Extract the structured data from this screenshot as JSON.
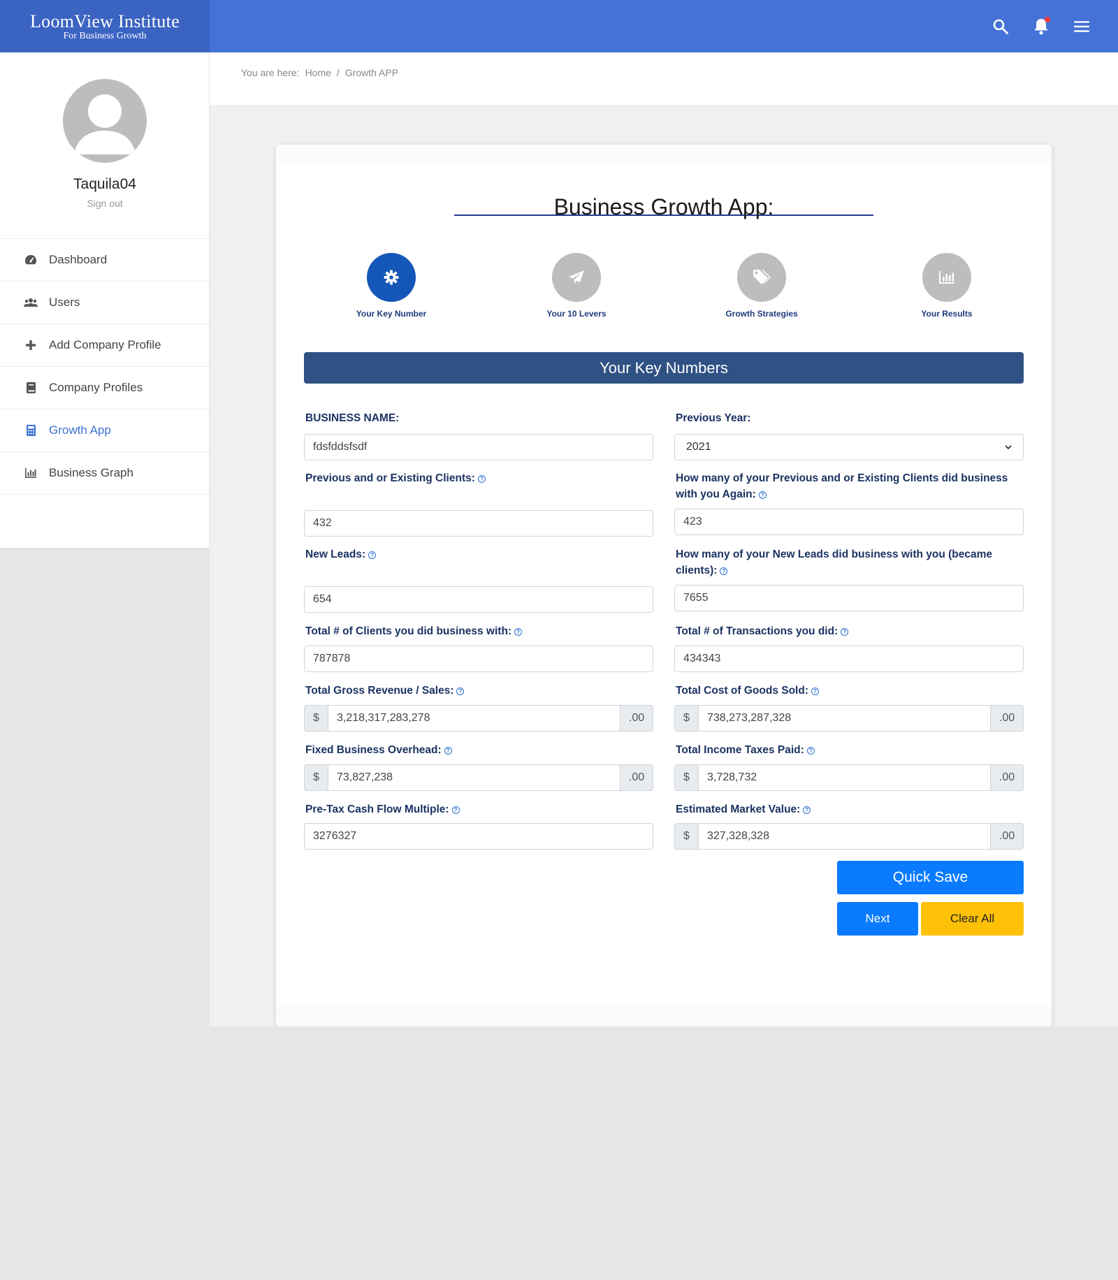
{
  "header": {
    "logo_line1": "LoomView Institute",
    "logo_line2": "For Business Growth",
    "icons": [
      "search-icon",
      "bell-icon",
      "menu-icon"
    ],
    "brand_color": "#4472d6"
  },
  "sidebar": {
    "username": "Taquila04",
    "signout": "Sign out",
    "items": [
      {
        "label": "Dashboard",
        "icon": "dashboard-icon"
      },
      {
        "label": "Users",
        "icon": "users-icon"
      },
      {
        "label": "Add Company Profile",
        "icon": "plus-icon"
      },
      {
        "label": "Company Profiles",
        "icon": "book-icon"
      },
      {
        "label": "Growth App",
        "icon": "calculator-icon",
        "active": true
      },
      {
        "label": "Business Graph",
        "icon": "bar-chart-icon"
      }
    ]
  },
  "breadcrumb": {
    "prefix": "You are here:",
    "home": "Home",
    "separator": "/",
    "current": "Growth APP"
  },
  "app": {
    "title": "Business Growth App:",
    "steps": [
      {
        "label": "Your Key Number",
        "icon": "gear-icon",
        "active": true
      },
      {
        "label": "Your 10 Levers",
        "icon": "paper-plane-icon"
      },
      {
        "label": "Growth Strategies",
        "icon": "tags-icon"
      },
      {
        "label": "Your Results",
        "icon": "bar-chart-icon"
      }
    ],
    "section_title": "Your Key Numbers"
  },
  "form": {
    "business_name": {
      "label": "BUSINESS NAME:",
      "value": "fdsfddsfsdf"
    },
    "previous_year": {
      "label": "Previous Year:",
      "value": "2021"
    },
    "prev_clients": {
      "label": "Previous and or Existing Clients:",
      "value": "432"
    },
    "repeat_clients": {
      "label": "How many of your Previous and or Existing Clients did business with you Again:",
      "value": "423"
    },
    "new_leads": {
      "label": "New Leads:",
      "value": "654"
    },
    "converted_leads": {
      "label": "How many of your New Leads did business with you (became clients):",
      "value": "7655"
    },
    "total_clients": {
      "label": "Total # of Clients you did business with:",
      "value": "787878"
    },
    "total_transactions": {
      "label": "Total # of Transactions you did:",
      "value": "434343"
    },
    "gross_revenue": {
      "label": "Total Gross Revenue / Sales:",
      "prefix": "$",
      "value": "3,218,317,283,278",
      "suffix": ".00"
    },
    "cogs": {
      "label": "Total Cost of Goods Sold:",
      "prefix": "$",
      "value": "738,273,287,328",
      "suffix": ".00"
    },
    "overhead": {
      "label": "Fixed Business Overhead:",
      "prefix": "$",
      "value": "73,827,238",
      "suffix": ".00"
    },
    "income_taxes": {
      "label": "Total Income Taxes Paid:",
      "prefix": "$",
      "value": "3,728,732",
      "suffix": ".00"
    },
    "cashflow_multiple": {
      "label": "Pre-Tax Cash Flow Multiple:",
      "value": "3276327"
    },
    "market_value": {
      "label": "Estimated Market Value:",
      "prefix": "$",
      "value": "327,328,328",
      "suffix": ".00"
    }
  },
  "actions": {
    "quick_save": "Quick Save",
    "next": "Next",
    "clear_all": "Clear All"
  }
}
